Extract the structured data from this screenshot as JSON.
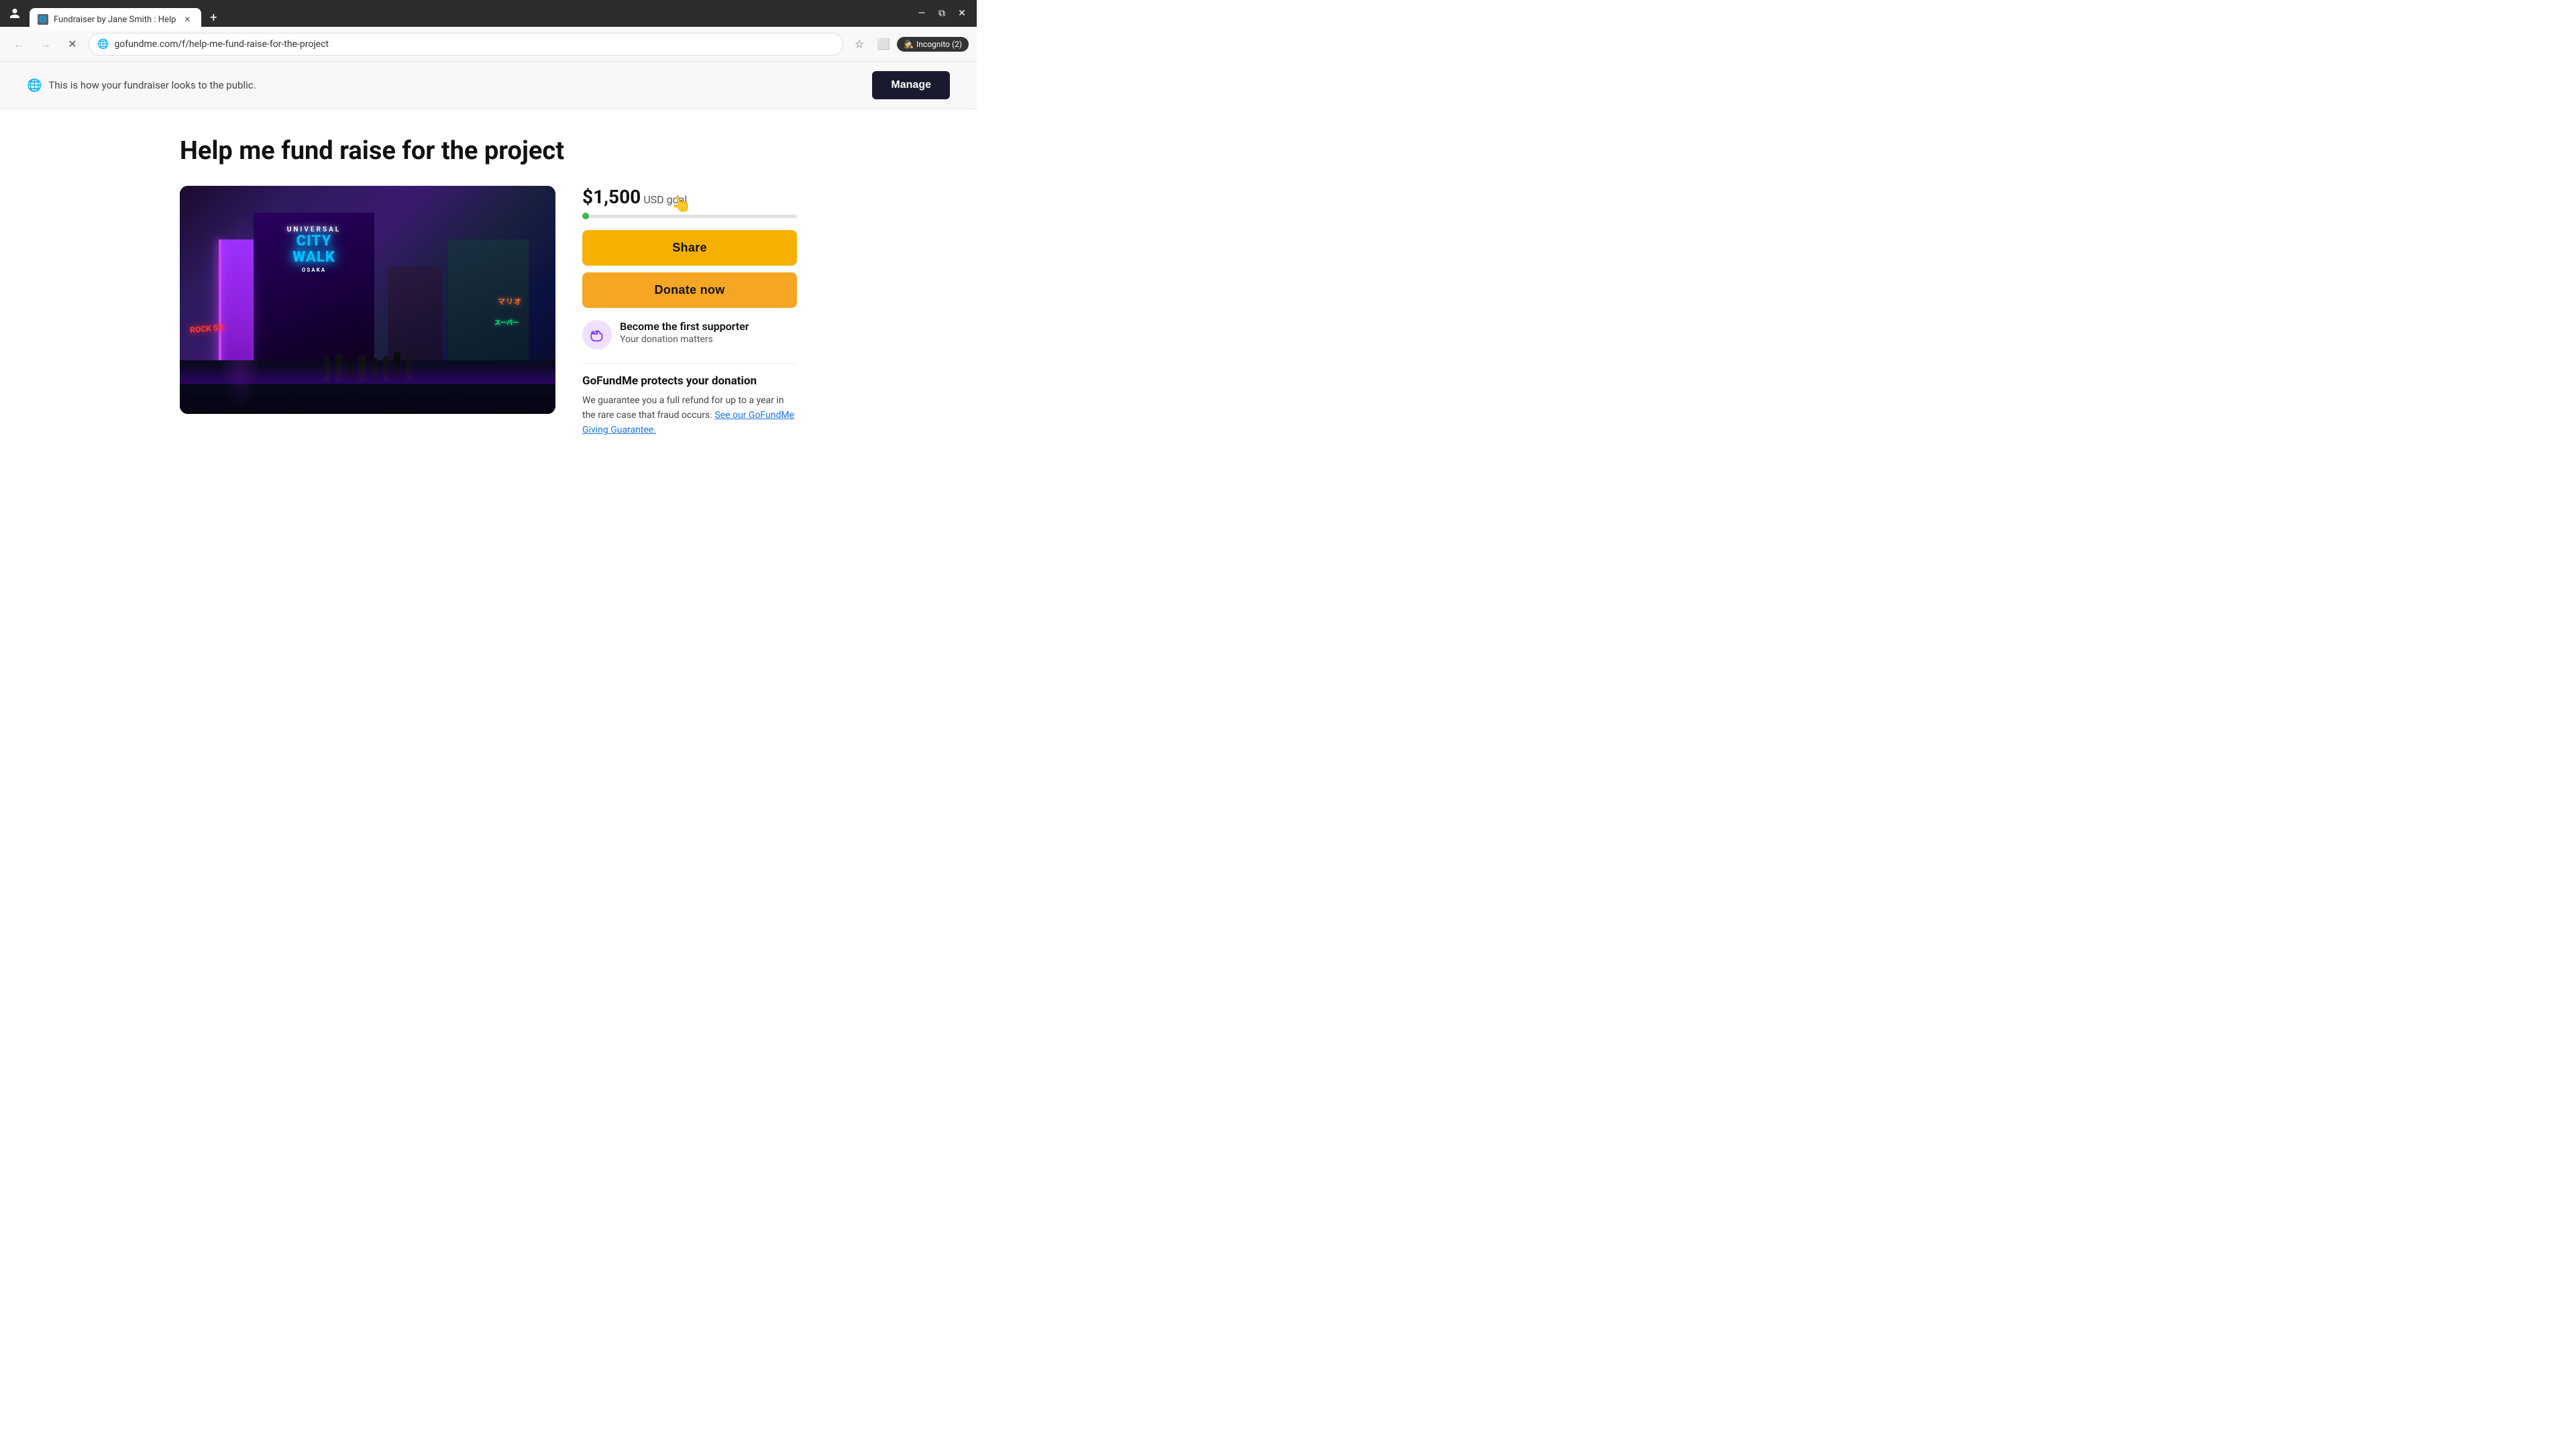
{
  "browser": {
    "tab": {
      "title": "Fundraiser by Jane Smith : Help",
      "favicon": "🌐"
    },
    "new_tab_label": "+",
    "toolbar": {
      "back_tooltip": "Back",
      "forward_tooltip": "Forward",
      "reload_tooltip": "Reload",
      "address": "gofundme.com/f/help-me-fund-raise-for-the-project",
      "bookmark_tooltip": "Bookmark",
      "profile_label": "Incognito (2)"
    }
  },
  "banner": {
    "notice_text": "This is how your fundraiser looks to the public.",
    "manage_label": "Manage"
  },
  "page": {
    "title": "Help me fund raise for the project",
    "goal_amount": "$1,500",
    "goal_label": "USD goal",
    "progress_percent": 2,
    "share_label": "Share",
    "donate_label": "Donate now",
    "supporter": {
      "heading": "Become the first supporter",
      "subtext": "Your donation matters"
    },
    "protection": {
      "title": "GoFundMe protects your donation",
      "text": "We guarantee you a full refund for up to a year in the rare case that fraud occurs.",
      "link_text": "See our GoFundMe Giving Guarantee.",
      "link_href": "#"
    }
  }
}
